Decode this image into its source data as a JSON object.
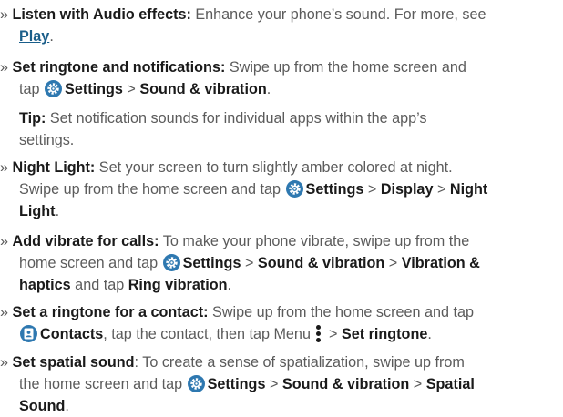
{
  "bullet": "»",
  "items": [
    {
      "lines": [
        [
          "Listen with Audio effects:",
          " Enhance your phone’s sound. For more, see"
        ],
        [
          "Play",
          "."
        ]
      ]
    },
    {
      "lines": [
        [
          "Set ringtone and notifications:",
          " Swipe up from the home screen and"
        ],
        [
          "tap ",
          "Settings",
          " > ",
          "Sound & vibration",
          "."
        ]
      ]
    },
    {
      "tip": [
        [
          "Tip:",
          " Set notification sounds for individual apps within the app’s"
        ],
        [
          "settings."
        ]
      ]
    },
    {
      "lines": [
        [
          "Night Light:",
          " Set your screen to turn slightly amber colored at night."
        ],
        [
          "Swipe up from the home screen and tap ",
          "Settings",
          " > ",
          "Display",
          " > ",
          "Night"
        ],
        [
          "Light",
          "."
        ]
      ]
    },
    {
      "lines": [
        [
          "Add vibrate for calls:",
          " To make your phone vibrate, swipe up from the"
        ],
        [
          "home screen and tap ",
          "Settings",
          " > ",
          "Sound & vibration",
          " > ",
          "Vibration &"
        ],
        [
          "haptics",
          " and tap ",
          "Ring vibration",
          "."
        ]
      ]
    },
    {
      "lines": [
        [
          "Set a ringtone for a contact:",
          " Swipe up from the home screen and tap"
        ],
        [
          "Contacts",
          ", tap the contact, then tap Menu ",
          " > ",
          "Set ringtone",
          "."
        ]
      ]
    },
    {
      "lines": [
        [
          "Set spatial sound",
          ": To create a sense of spatialization, swipe up from"
        ],
        [
          "the home screen and tap ",
          "Settings",
          " > ",
          "Sound & vibration",
          " > ",
          "Spatial"
        ],
        [
          "Sound",
          "."
        ]
      ]
    }
  ],
  "icons": {
    "settings": "settings-gear-icon",
    "contacts": "contacts-icon",
    "menu": "menu-kebab-icon"
  },
  "colors": {
    "text": "#5b5b5b",
    "bold": "#1a1a1a",
    "link": "#1a5e8a",
    "icon_bg": "#2e78b0"
  }
}
